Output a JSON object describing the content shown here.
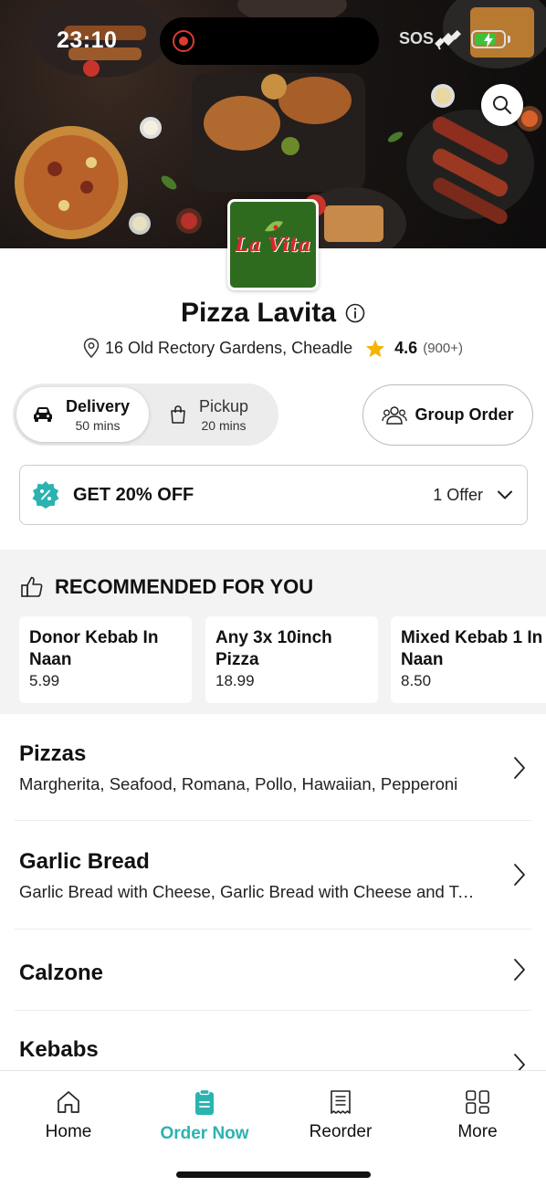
{
  "status_bar": {
    "time": "23:10",
    "carrier": "SOS",
    "battery_level": 0.75
  },
  "colors": {
    "accent": "#2bb3b0",
    "star": "#f5b400",
    "logo_bg": "#2e6b1f",
    "logo_text": "#d8262c"
  },
  "hero": {
    "search_icon": "search-icon"
  },
  "restaurant": {
    "logo_text": "La Vita",
    "name": "Pizza Lavita",
    "address": "16 Old Rectory Gardens, Cheadle",
    "rating": "4.6",
    "rating_count": "(900+)"
  },
  "modes": {
    "delivery": {
      "label": "Delivery",
      "time": "50 mins",
      "selected": true
    },
    "pickup": {
      "label": "Pickup",
      "time": "20 mins",
      "selected": false
    }
  },
  "group_order": {
    "label": "Group Order"
  },
  "offer": {
    "title": "GET 20% OFF",
    "count": "1 Offer"
  },
  "recommended": {
    "title": "RECOMMENDED FOR YOU",
    "items": [
      {
        "name": "Donor Kebab In Naan",
        "price": "5.99"
      },
      {
        "name": "Any 3x 10inch Pizza",
        "price": "18.99"
      },
      {
        "name": "Mixed Kebab 1 In Naan",
        "price": "8.50"
      }
    ]
  },
  "categories": [
    {
      "title": "Pizzas",
      "desc": "Margherita, Seafood, Romana, Pollo, Hawaiian, Pepperoni"
    },
    {
      "title": "Garlic Bread",
      "desc": "Garlic Bread with Cheese, Garlic Bread with Cheese and Tomato"
    },
    {
      "title": "Calzone",
      "desc": ""
    },
    {
      "title": "Kebabs",
      "desc": ""
    }
  ],
  "tabs": [
    {
      "label": "Home",
      "icon": "home-icon"
    },
    {
      "label": "Order Now",
      "icon": "order-icon",
      "active": true
    },
    {
      "label": "Reorder",
      "icon": "receipt-icon"
    },
    {
      "label": "More",
      "icon": "grid-icon"
    }
  ]
}
